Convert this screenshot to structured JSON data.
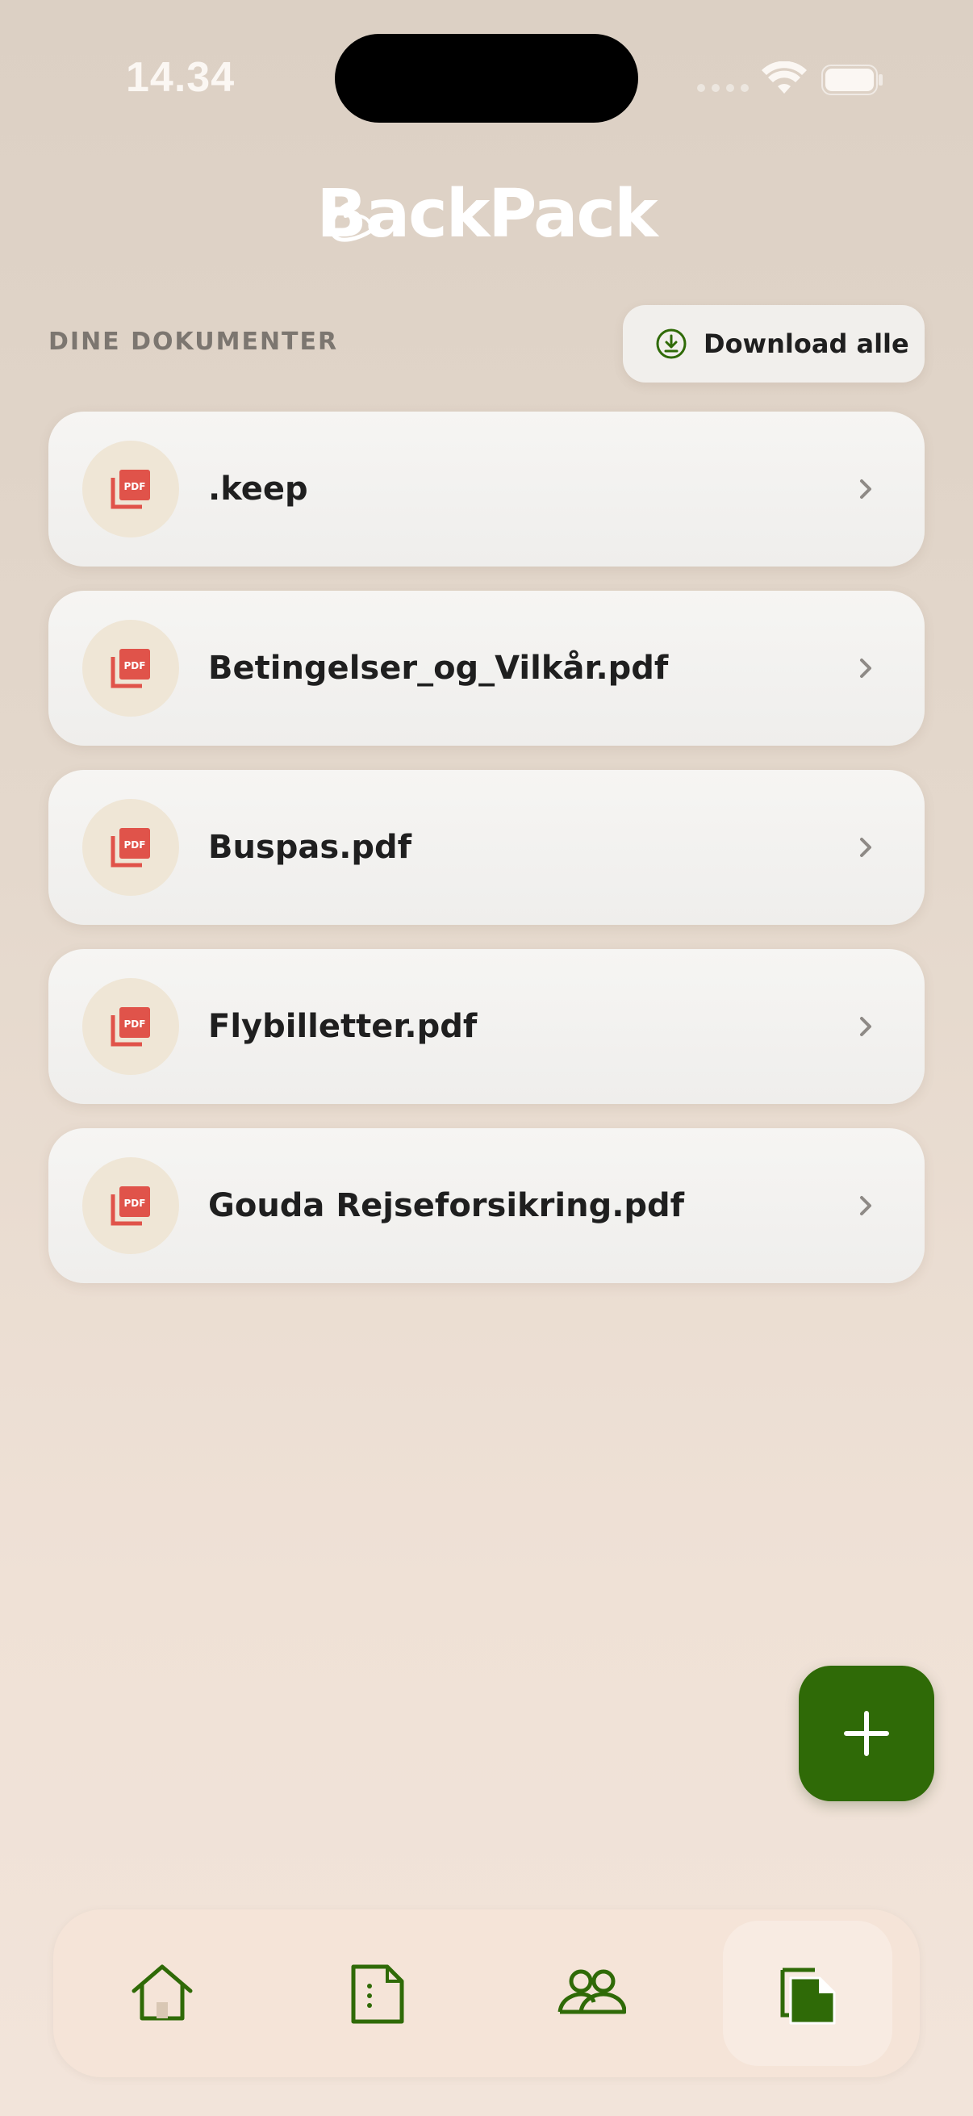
{
  "status_bar": {
    "time": "14.34"
  },
  "app": {
    "logo_text": "BackPack"
  },
  "documents_section": {
    "title": "DINE DOKUMENTER",
    "download_all_label": "Download alle",
    "items": [
      {
        "name": ".keep",
        "icon": "pdf-icon"
      },
      {
        "name": "Betingelser_og_Vilkår.pdf",
        "icon": "pdf-icon"
      },
      {
        "name": "Buspas.pdf",
        "icon": "pdf-icon"
      },
      {
        "name": "Flybilletter.pdf",
        "icon": "pdf-icon"
      },
      {
        "name": "Gouda Rejseforsikring.pdf",
        "icon": "pdf-icon"
      }
    ]
  },
  "fab": {
    "icon": "plus-icon"
  },
  "tab_bar": {
    "tabs": [
      {
        "icon": "home-icon",
        "active": false
      },
      {
        "icon": "document-notes-icon",
        "active": false
      },
      {
        "icon": "people-icon",
        "active": false
      },
      {
        "icon": "files-icon",
        "active": true
      }
    ]
  },
  "colors": {
    "accent_green": "#2f6a07",
    "pdf_red": "#e0534a",
    "background": "#e4d8cc"
  }
}
